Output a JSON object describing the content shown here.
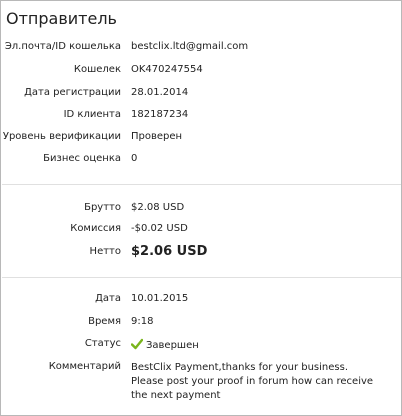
{
  "sender": {
    "title": "Отправитель",
    "fields": [
      {
        "label": "Эл.почта/ID кошелька",
        "value": "bestclix.ltd@gmail.com"
      },
      {
        "label": "Кошелек",
        "value": "OK470247554"
      },
      {
        "label": "Дата регистрации",
        "value": "28.01.2014"
      },
      {
        "label": "ID клиента",
        "value": "182187234"
      },
      {
        "label": "Уровень верификации",
        "value": "Проверен"
      },
      {
        "label": "Бизнес оценка",
        "value": "0"
      }
    ]
  },
  "amounts": {
    "gross_label": "Брутто",
    "gross_value": "$2.08 USD",
    "fee_label": "Комиссия",
    "fee_value": "-$0.02 USD",
    "net_label": "Нетто",
    "net_value": "$2.06 USD"
  },
  "details": {
    "date_label": "Дата",
    "date_value": "10.01.2015",
    "time_label": "Время",
    "time_value": "9:18",
    "status_label": "Статус",
    "status_value": "Завершен",
    "status_icon": "checkmark-icon",
    "status_color": "#7ab51d",
    "comment_label": "Комментарий",
    "comment_lines": [
      "BestClix Payment,thanks for your business.",
      "Please post your proof in forum how can receive",
      "the next payment"
    ]
  }
}
